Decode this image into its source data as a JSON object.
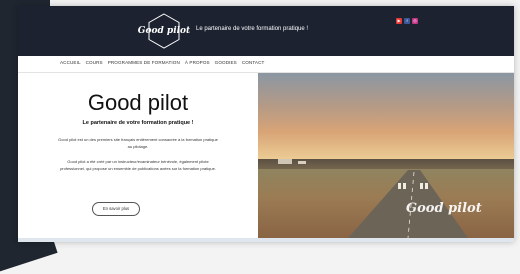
{
  "site": {
    "logo_text": "Good pilot",
    "tagline": "Le partenaire de votre formation pratique !"
  },
  "socials": [
    {
      "name": "youtube-icon",
      "color": "#e53935",
      "glyph": "▶"
    },
    {
      "name": "facebook-icon",
      "color": "#3b5998",
      "glyph": "f"
    },
    {
      "name": "instagram-icon",
      "color": "#c13584",
      "glyph": "◎"
    }
  ],
  "nav": {
    "items": [
      "Accueil",
      "Cours",
      "Programmes de formation",
      "À propos",
      "Goodies",
      "Contact"
    ]
  },
  "hero": {
    "title": "Good pilot",
    "subtitle": "Le partenaire de votre formation pratique !",
    "paragraph1": "Good pilot est un des premiers site français entièrement consacrée à la formation pratique au pilotage.",
    "paragraph2": "Good pilot a été créé par un instructeur/examinateur bénévole, également pilote professionnel, qui propose un ensemble de publications axées sur la formation pratique.",
    "button_label": "En savoir plus",
    "photo_logo": "Good pilot"
  }
}
